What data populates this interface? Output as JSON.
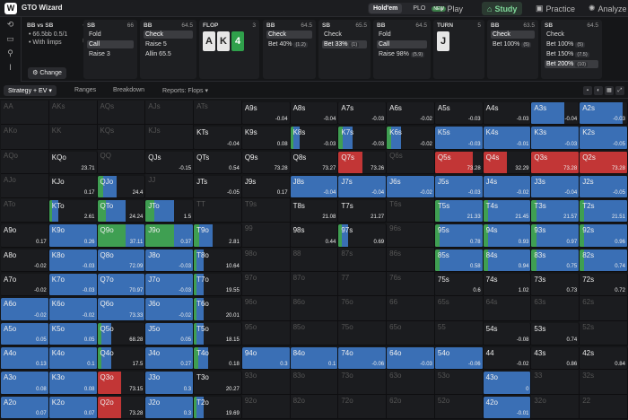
{
  "app": {
    "title": "GTO Wizard"
  },
  "variant": {
    "holdem": "Hold'em",
    "plo": "PLO",
    "plo_badge": "NEW"
  },
  "nav": {
    "play": "Play",
    "study": "Study",
    "practice": "Practice",
    "analyze": "Analyze"
  },
  "scenario": {
    "title": "BB vs SB",
    "line1": "66.5bb 0.5/1",
    "line2": "With limps",
    "change": "Change"
  },
  "nodes": [
    {
      "pos": "SB",
      "stack": "66",
      "actions": [
        {
          "label": "Fold"
        },
        {
          "label": "Call",
          "sel": true
        },
        {
          "label": "Raise 3"
        }
      ]
    },
    {
      "pos": "BB",
      "stack": "64.5",
      "actions": [
        {
          "label": "Check",
          "sel": true
        },
        {
          "label": "Raise 5"
        },
        {
          "label": "Allin 65.5"
        }
      ]
    },
    {
      "pos": "FLOP",
      "stack": "3",
      "cards": [
        "A",
        "K",
        "4"
      ]
    },
    {
      "pos": "BB",
      "stack": "64.5",
      "actions": [
        {
          "label": "Check",
          "sel": true
        },
        {
          "label": "Bet 40%",
          "tag": "(1.2)"
        }
      ]
    },
    {
      "pos": "SB",
      "stack": "65.5",
      "actions": [
        {
          "label": "Check"
        },
        {
          "label": "Bet 33%",
          "tag": "(1)",
          "sel": true
        }
      ]
    },
    {
      "pos": "BB",
      "stack": "64.5",
      "actions": [
        {
          "label": "Fold"
        },
        {
          "label": "Call",
          "sel": true
        },
        {
          "label": "Raise 98%",
          "tag": "(5.9)"
        }
      ]
    },
    {
      "pos": "TURN",
      "stack": "5",
      "cards": [
        "J"
      ]
    },
    {
      "pos": "BB",
      "stack": "63.5",
      "actions": [
        {
          "label": "Check",
          "sel": true
        },
        {
          "label": "Bet 100%",
          "tag": "(5)"
        }
      ]
    },
    {
      "pos": "SB",
      "stack": "64.5",
      "actions": [
        {
          "label": "Check"
        },
        {
          "label": "Bet 100%",
          "tag": "(5)"
        },
        {
          "label": "Bet 150%",
          "tag": "(7.5)"
        },
        {
          "label": "Bet 200%",
          "tag": "(10)",
          "sel": true
        }
      ]
    }
  ],
  "subtabs": {
    "strategy": "Strategy + EV",
    "ranges": "Ranges",
    "breakdown": "Breakdown",
    "reports": "Reports: Flops"
  },
  "colors": {
    "fold": "#3a6fb5",
    "call": "#3f9f52",
    "raise": "#c23636"
  },
  "matrix": [
    [
      "AA",
      "",
      "",
      ""
    ],
    [
      "AKs",
      "",
      "",
      ""
    ],
    [
      "AQs",
      "",
      "",
      ""
    ],
    [
      "AJs",
      "",
      "",
      ""
    ],
    [
      "ATs",
      "",
      "",
      ""
    ],
    [
      "A9s",
      "-0.04",
      "",
      ""
    ],
    [
      "A8s",
      "-0.04",
      "",
      ""
    ],
    [
      "A7s",
      "-0.03",
      "",
      ""
    ],
    [
      "A6s",
      "-0.02",
      "",
      ""
    ],
    [
      "A5s",
      "-0.03",
      "",
      ""
    ],
    [
      "A4s",
      "-0.03",
      "",
      ""
    ],
    [
      "A3s",
      "-0.04",
      "0.7f",
      ""
    ],
    [
      "A2s",
      "-0.03",
      "0.9f",
      ""
    ],
    [
      "AKo",
      "",
      "",
      ""
    ],
    [
      "KK",
      "",
      "",
      ""
    ],
    [
      "KQs",
      "",
      "",
      ""
    ],
    [
      "KJs",
      "",
      "",
      ""
    ],
    [
      "KTs",
      "-0.04",
      "",
      ""
    ],
    [
      "K9s",
      "0.08",
      "",
      ""
    ],
    [
      "K8s",
      "-0.03",
      "0.2",
      ""
    ],
    [
      "K7s",
      "-0.03",
      "0.3",
      ""
    ],
    [
      "K6s",
      "-0.02",
      "0.3",
      ""
    ],
    [
      "K5s",
      "-0.03",
      "1f",
      ""
    ],
    [
      "K4s",
      "-0.01",
      "1f",
      ""
    ],
    [
      "K3s",
      "-0.03",
      "1f",
      ""
    ],
    [
      "K2s",
      "-0.05",
      "1f",
      ""
    ],
    [
      "AQo",
      "",
      "",
      ""
    ],
    [
      "KQo",
      "23.71",
      "",
      ""
    ],
    [
      "QQ",
      "",
      "",
      ""
    ],
    [
      "QJs",
      "-0.15",
      "",
      ""
    ],
    [
      "QTs",
      "0.54",
      "",
      ""
    ],
    [
      "Q9s",
      "73.28",
      "",
      ""
    ],
    [
      "Q8s",
      "73.27",
      "",
      ""
    ],
    [
      "Q7s",
      "73.26",
      "0.5r",
      ""
    ],
    [
      "Q6s",
      "",
      "",
      ""
    ],
    [
      "Q5s",
      "73.28",
      "0.8r",
      ""
    ],
    [
      "Q4s",
      "32.29",
      "0.5r",
      ""
    ],
    [
      "Q3s",
      "73.28",
      "1r",
      ""
    ],
    [
      "Q2s",
      "73.28",
      "1r",
      ""
    ],
    [
      "AJo",
      "",
      "",
      ""
    ],
    [
      "KJo",
      "0.17",
      "",
      ""
    ],
    [
      "QJo",
      "24.4",
      "0.4",
      ""
    ],
    [
      "JJ",
      "",
      "",
      ""
    ],
    [
      "JTs",
      "-0.05",
      "",
      ""
    ],
    [
      "J9s",
      "0.17",
      "",
      ""
    ],
    [
      "J8s",
      "-0.04",
      "1f",
      ""
    ],
    [
      "J7s",
      "-0.04",
      "1f",
      ""
    ],
    [
      "J6s",
      "-0.02",
      "1f",
      ""
    ],
    [
      "J5s",
      "-0.03",
      "1f",
      ""
    ],
    [
      "J4s",
      "-0.02",
      "1f",
      ""
    ],
    [
      "J3s",
      "-0.04",
      "1f",
      ""
    ],
    [
      "J2s",
      "-0.05",
      "1f",
      ""
    ],
    [
      "ATo",
      "",
      "",
      ""
    ],
    [
      "KTo",
      "2.61",
      "0.2c",
      ""
    ],
    [
      "QTo",
      "24.24",
      "0.6c",
      ""
    ],
    [
      "JTo",
      "1.5",
      "0.6c",
      ""
    ],
    [
      "TT",
      "",
      "",
      ""
    ],
    [
      "T9s",
      "",
      "",
      ""
    ],
    [
      "T8s",
      "21.08",
      "",
      ""
    ],
    [
      "T7s",
      "21.27",
      "",
      ""
    ],
    [
      "T6s",
      "",
      "",
      ""
    ],
    [
      "T5s",
      "21.33",
      "1c",
      ""
    ],
    [
      "T4s",
      "21.45",
      "1c",
      ""
    ],
    [
      "T3s",
      "21.57",
      "1c",
      ""
    ],
    [
      "T2s",
      "21.51",
      "1c",
      ""
    ],
    [
      "A9o",
      "0.17",
      "",
      ""
    ],
    [
      "K9o",
      "0.26",
      "1f",
      ""
    ],
    [
      "Q9o",
      "37.11",
      "1m",
      ""
    ],
    [
      "J9o",
      "0.37",
      "1m",
      ""
    ],
    [
      "T9o",
      "2.81",
      "0.4c",
      ""
    ],
    [
      "99",
      "",
      "",
      ""
    ],
    [
      "98s",
      "0.44",
      "",
      ""
    ],
    [
      "97s",
      "0.69",
      "0.2",
      ""
    ],
    [
      "96s",
      "",
      "",
      ""
    ],
    [
      "95s",
      "0.78",
      "1c",
      ""
    ],
    [
      "94s",
      "0.93",
      "1c",
      ""
    ],
    [
      "93s",
      "0.97",
      "1c",
      ""
    ],
    [
      "92s",
      "0.96",
      "1c",
      ""
    ],
    [
      "A8o",
      "-0.02",
      "",
      ""
    ],
    [
      "K8o",
      "-0.03",
      "1f",
      ""
    ],
    [
      "Q8o",
      "72.09",
      "1f",
      ""
    ],
    [
      "J8o",
      "-0.03",
      "1f",
      ""
    ],
    [
      "T8o",
      "10.64",
      "0.2",
      ""
    ],
    [
      "98o",
      "",
      "",
      ""
    ],
    [
      "88",
      "",
      "",
      ""
    ],
    [
      "87s",
      "",
      "",
      ""
    ],
    [
      "86s",
      "",
      "",
      ""
    ],
    [
      "85s",
      "0.58",
      "1c",
      ""
    ],
    [
      "84s",
      "0.94",
      "1c",
      ""
    ],
    [
      "83s",
      "0.75",
      "1c",
      ""
    ],
    [
      "82s",
      "0.74",
      "1c",
      ""
    ],
    [
      "A7o",
      "-0.02",
      "",
      ""
    ],
    [
      "K7o",
      "-0.03",
      "1f",
      ""
    ],
    [
      "Q7o",
      "70.97",
      "1f",
      ""
    ],
    [
      "J7o",
      "-0.03",
      "1f",
      ""
    ],
    [
      "T7o",
      "19.55",
      "0.2",
      ""
    ],
    [
      "97o",
      "",
      "",
      ""
    ],
    [
      "87o",
      "",
      "",
      ""
    ],
    [
      "77",
      "",
      "",
      ""
    ],
    [
      "76s",
      "",
      "",
      ""
    ],
    [
      "75s",
      "0.6",
      "",
      ""
    ],
    [
      "74s",
      "1.02",
      "",
      ""
    ],
    [
      "73s",
      "0.73",
      "",
      ""
    ],
    [
      "72s",
      "0.72",
      "",
      ""
    ],
    [
      "A6o",
      "-0.02",
      "1f",
      ""
    ],
    [
      "K6o",
      "-0.02",
      "1f",
      ""
    ],
    [
      "Q6o",
      "73.33",
      "1f",
      ""
    ],
    [
      "J6o",
      "-0.02",
      "1f",
      ""
    ],
    [
      "T6o",
      "20.01",
      "0.2",
      ""
    ],
    [
      "96o",
      "",
      "",
      ""
    ],
    [
      "86o",
      "",
      "",
      ""
    ],
    [
      "76o",
      "",
      "",
      ""
    ],
    [
      "66",
      "",
      "",
      ""
    ],
    [
      "65s",
      "",
      "",
      ""
    ],
    [
      "64s",
      "",
      "",
      ""
    ],
    [
      "63s",
      "",
      "",
      ""
    ],
    [
      "62s",
      "",
      "",
      ""
    ],
    [
      "A5o",
      "0.05",
      "1f",
      ""
    ],
    [
      "K5o",
      "0.05",
      "1f",
      ""
    ],
    [
      "Q5o",
      "68.28",
      "0.3",
      ""
    ],
    [
      "J5o",
      "0.05",
      "1f",
      ""
    ],
    [
      "T5o",
      "18.15",
      "0.2",
      ""
    ],
    [
      "95o",
      "",
      "",
      ""
    ],
    [
      "85o",
      "",
      "",
      ""
    ],
    [
      "75o",
      "",
      "",
      ""
    ],
    [
      "65o",
      "",
      "",
      ""
    ],
    [
      "55",
      "",
      "",
      ""
    ],
    [
      "54s",
      "-0.08",
      "",
      ""
    ],
    [
      "53s",
      "0.74",
      "",
      ""
    ],
    [
      "52s",
      "",
      "",
      ""
    ],
    [
      "A4o",
      "0.13",
      "1f",
      ""
    ],
    [
      "K4o",
      "0.1",
      "1f",
      ""
    ],
    [
      "Q4o",
      "17.5",
      "0.3",
      ""
    ],
    [
      "J4o",
      "0.27",
      "1f",
      ""
    ],
    [
      "T4o",
      "0.18",
      "0.3",
      ""
    ],
    [
      "94o",
      "0.3",
      "1f",
      ""
    ],
    [
      "84o",
      "0.1",
      "1f",
      ""
    ],
    [
      "74o",
      "-0.06",
      "1f",
      ""
    ],
    [
      "64o",
      "-0.03",
      "1f",
      ""
    ],
    [
      "54o",
      "-0.06",
      "1f",
      ""
    ],
    [
      "44",
      "-0.02",
      "",
      ""
    ],
    [
      "43s",
      "0.86",
      "",
      ""
    ],
    [
      "42s",
      "0.84",
      "",
      ""
    ],
    [
      "A3o",
      "0.08",
      "1f",
      ""
    ],
    [
      "K3o",
      "0.08",
      "1f",
      ""
    ],
    [
      "Q3o",
      "73.15",
      "0.5r",
      ""
    ],
    [
      "J3o",
      "0.3",
      "1f",
      ""
    ],
    [
      "T3o",
      "20.27",
      "",
      ""
    ],
    [
      "93o",
      "",
      "",
      ""
    ],
    [
      "83o",
      "",
      "",
      ""
    ],
    [
      "73o",
      "",
      "",
      ""
    ],
    [
      "63o",
      "",
      "",
      ""
    ],
    [
      "53o",
      "",
      "",
      ""
    ],
    [
      "43o",
      "0",
      "1f",
      ""
    ],
    [
      "33",
      "",
      "",
      ""
    ],
    [
      "32s",
      "",
      "",
      ""
    ],
    [
      "A2o",
      "0.07",
      "1f",
      ""
    ],
    [
      "K2o",
      "0.07",
      "1f",
      ""
    ],
    [
      "Q2o",
      "73.28",
      "0.5r",
      ""
    ],
    [
      "J2o",
      "0.3",
      "1f",
      ""
    ],
    [
      "T2o",
      "19.69",
      "0.2",
      ""
    ],
    [
      "92o",
      "",
      "",
      ""
    ],
    [
      "82o",
      "",
      "",
      ""
    ],
    [
      "72o",
      "",
      "",
      ""
    ],
    [
      "62o",
      "",
      "",
      ""
    ],
    [
      "52o",
      "",
      "",
      ""
    ],
    [
      "42o",
      "-0.01",
      "1f",
      ""
    ],
    [
      "32o",
      "",
      "",
      ""
    ],
    [
      "22",
      "",
      "",
      ""
    ]
  ]
}
